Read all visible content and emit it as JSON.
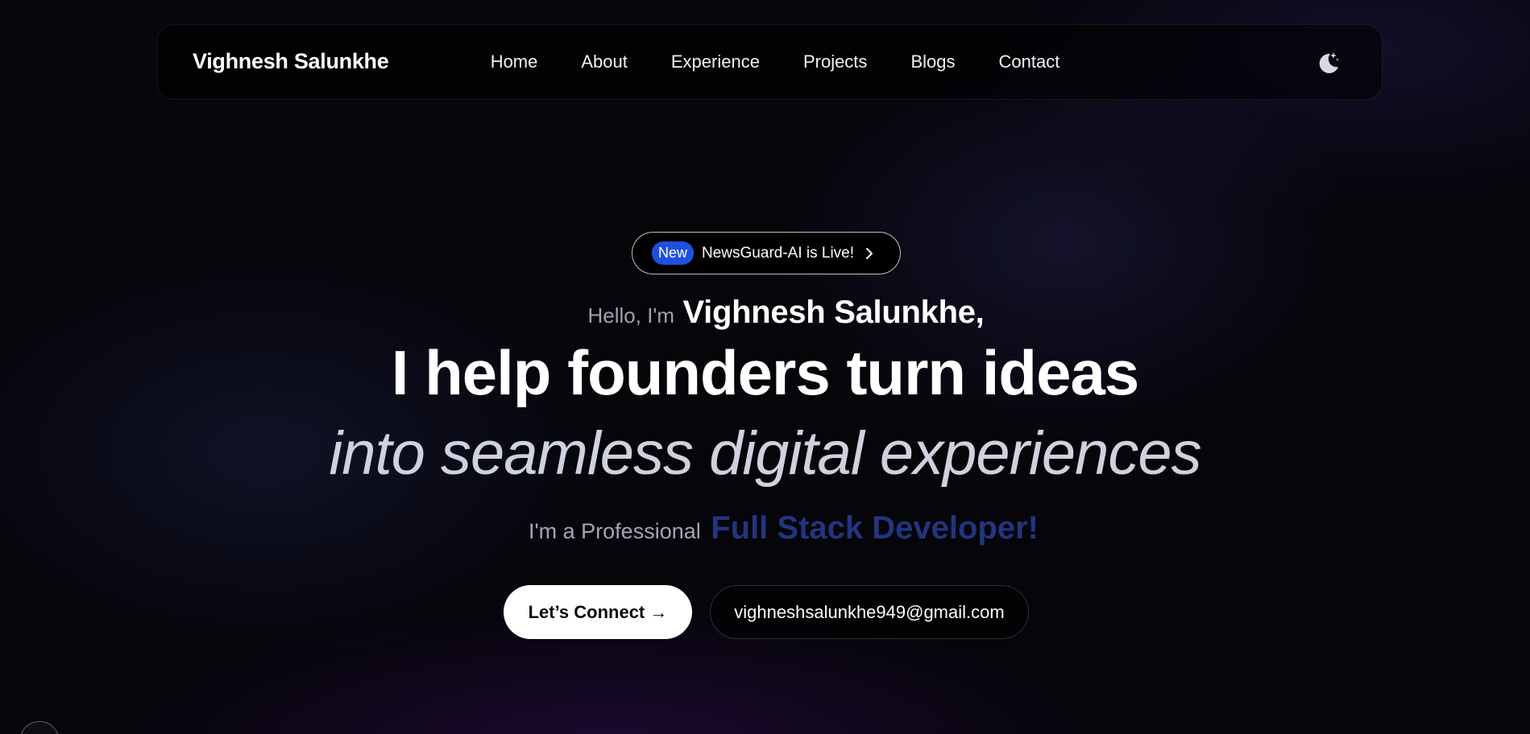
{
  "nav": {
    "brand": "Vighnesh Salunkhe",
    "links": [
      "Home",
      "About",
      "Experience",
      "Projects",
      "Blogs",
      "Contact"
    ],
    "theme_icon": "moon-stars-icon"
  },
  "announcement": {
    "badge": "New",
    "text": "NewsGuard-AI is Live!",
    "icon": "chevron-right-icon"
  },
  "hero": {
    "greeting": "Hello, I'm",
    "name": "Vighnesh Salunkhe,",
    "headline": "I help founders turn ideas",
    "subline": "into seamless digital experiences",
    "role_prefix": "I'm a Professional",
    "role_title": "Full Stack Developer!"
  },
  "actions": {
    "connect": "Let’s Connect →",
    "email": "vighneshsalunkhe949@gmail.com"
  },
  "colors": {
    "accent_blue": "#1f4fe0",
    "role_blue": "#22357e",
    "background": "#05050a"
  }
}
